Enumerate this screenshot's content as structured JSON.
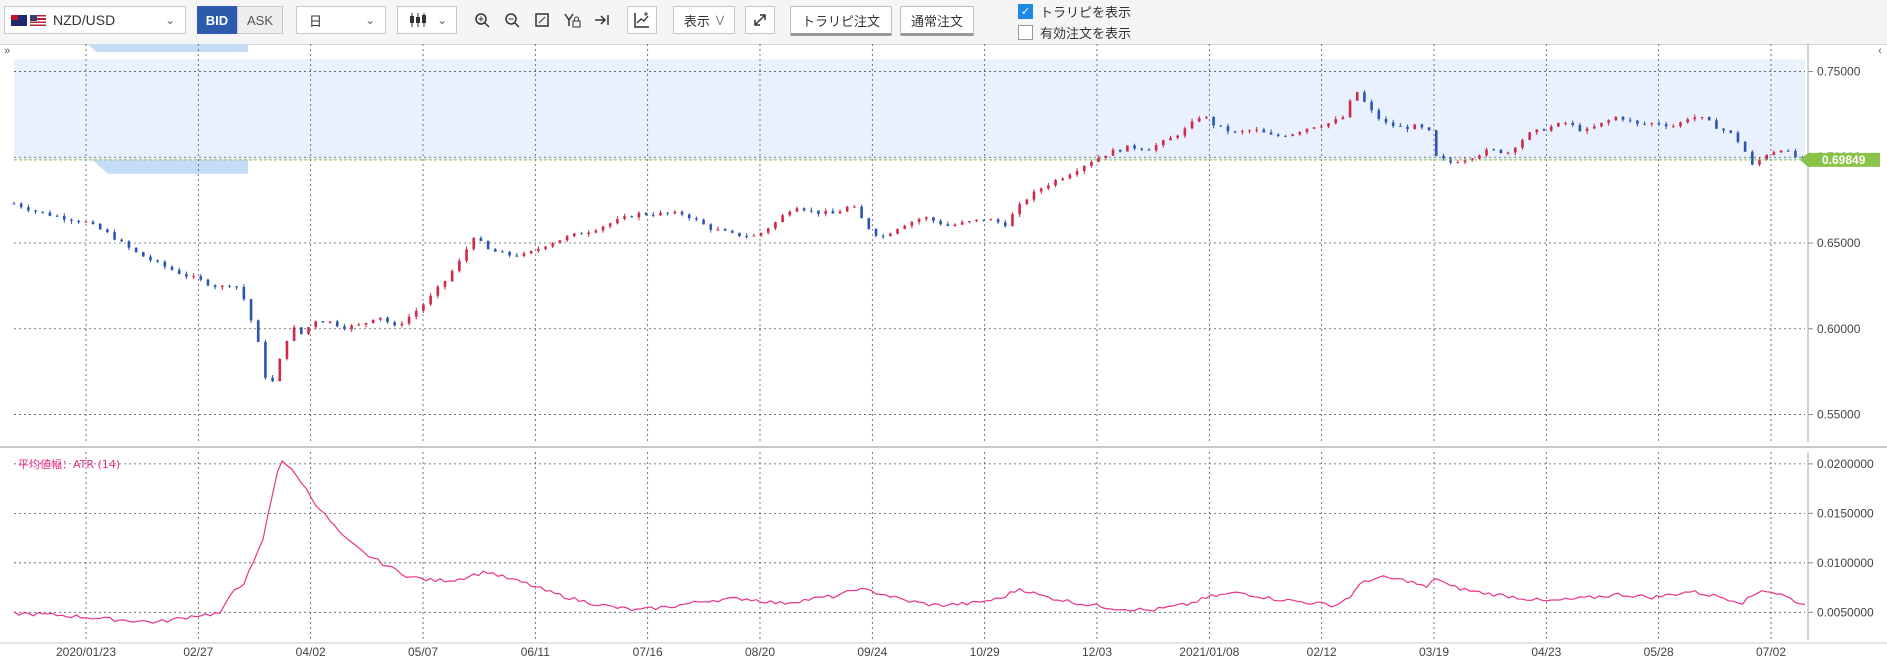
{
  "toolbar": {
    "pair": "NZD/USD",
    "bid": "BID",
    "ask": "ASK",
    "timeframe": "日",
    "display_label": "表示",
    "trapi_order": "トラリピ注文",
    "normal_order": "通常注文",
    "show_trapi": "トラリピを表示",
    "show_active": "有効注文を表示",
    "show_trapi_checked": true,
    "show_active_checked": false
  },
  "icons": [
    "candlestick-icon",
    "zoom-in-icon",
    "zoom-out-icon",
    "fit-icon",
    "y-lock-icon",
    "scroll-end-icon",
    "indicator-icon",
    "expand-icon"
  ],
  "colors": {
    "up": "#d0294a",
    "down": "#2a55b3",
    "atr": "#e8338a",
    "price_tag": "#8bc34a",
    "range_fill": "#e8f1fd"
  },
  "chart_data": [
    {
      "type": "candlestick",
      "pair": "NZD/USD",
      "y_ticks": [
        "0.75000",
        "0.70000",
        "0.65000",
        "0.60000",
        "0.55000"
      ],
      "ylim": [
        0.534,
        0.766
      ],
      "current_price": "0.69849",
      "trapi_range": [
        0.6985,
        0.757
      ],
      "x_ticks": [
        "2020/01/23",
        "02/27",
        "04/02",
        "05/07",
        "06/11",
        "07/16",
        "08/20",
        "09/24",
        "10/29",
        "12/03",
        "2021/01/08",
        "02/12",
        "03/19",
        "04/23",
        "05/28",
        "07/02"
      ],
      "close_path": [
        [
          0,
          0.673
        ],
        [
          10,
          0.668
        ],
        [
          20,
          0.665
        ],
        [
          30,
          0.662
        ],
        [
          40,
          0.655
        ],
        [
          50,
          0.645
        ],
        [
          60,
          0.638
        ],
        [
          70,
          0.632
        ],
        [
          78,
          0.628
        ],
        [
          86,
          0.624
        ],
        [
          92,
          0.627
        ],
        [
          97,
          0.615
        ],
        [
          100,
          0.6
        ],
        [
          103,
          0.587
        ],
        [
          106,
          0.565
        ],
        [
          109,
          0.571
        ],
        [
          112,
          0.587
        ],
        [
          116,
          0.601
        ],
        [
          120,
          0.597
        ],
        [
          126,
          0.605
        ],
        [
          132,
          0.604
        ],
        [
          138,
          0.601
        ],
        [
          145,
          0.602
        ],
        [
          152,
          0.608
        ],
        [
          159,
          0.601
        ],
        [
          166,
          0.608
        ],
        [
          173,
          0.617
        ],
        [
          180,
          0.628
        ],
        [
          186,
          0.639
        ],
        [
          192,
          0.654
        ],
        [
          198,
          0.646
        ],
        [
          206,
          0.643
        ],
        [
          214,
          0.643
        ],
        [
          222,
          0.649
        ],
        [
          230,
          0.653
        ],
        [
          240,
          0.657
        ],
        [
          250,
          0.662
        ],
        [
          260,
          0.667
        ],
        [
          270,
          0.667
        ],
        [
          280,
          0.667
        ],
        [
          290,
          0.659
        ],
        [
          300,
          0.655
        ],
        [
          310,
          0.654
        ],
        [
          318,
          0.662
        ],
        [
          326,
          0.672
        ],
        [
          334,
          0.668
        ],
        [
          342,
          0.667
        ],
        [
          350,
          0.672
        ],
        [
          356,
          0.66
        ],
        [
          362,
          0.653
        ],
        [
          370,
          0.66
        ],
        [
          380,
          0.665
        ],
        [
          390,
          0.66
        ],
        [
          398,
          0.662
        ],
        [
          406,
          0.664
        ],
        [
          414,
          0.661
        ],
        [
          422,
          0.675
        ],
        [
          430,
          0.683
        ],
        [
          440,
          0.69
        ],
        [
          450,
          0.698
        ],
        [
          458,
          0.703
        ],
        [
          466,
          0.706
        ],
        [
          474,
          0.705
        ],
        [
          482,
          0.71
        ],
        [
          490,
          0.717
        ],
        [
          496,
          0.725
        ],
        [
          502,
          0.718
        ],
        [
          510,
          0.714
        ],
        [
          518,
          0.716
        ],
        [
          526,
          0.712
        ],
        [
          534,
          0.714
        ],
        [
          542,
          0.718
        ],
        [
          550,
          0.72
        ],
        [
          556,
          0.724
        ],
        [
          560,
          0.74
        ],
        [
          566,
          0.728
        ],
        [
          572,
          0.72
        ],
        [
          580,
          0.717
        ],
        [
          586,
          0.718
        ],
        [
          592,
          0.714
        ],
        [
          594,
          0.7
        ],
        [
          600,
          0.697
        ],
        [
          608,
          0.7
        ],
        [
          616,
          0.704
        ],
        [
          624,
          0.703
        ],
        [
          632,
          0.713
        ],
        [
          640,
          0.717
        ],
        [
          648,
          0.72
        ],
        [
          656,
          0.715
        ],
        [
          664,
          0.72
        ],
        [
          670,
          0.724
        ],
        [
          678,
          0.719
        ],
        [
          686,
          0.72
        ],
        [
          694,
          0.718
        ],
        [
          700,
          0.724
        ],
        [
          706,
          0.722
        ],
        [
          712,
          0.717
        ],
        [
          718,
          0.713
        ],
        [
          722,
          0.706
        ],
        [
          726,
          0.695
        ],
        [
          732,
          0.702
        ],
        [
          738,
          0.705
        ],
        [
          744,
          0.7
        ],
        [
          748,
          0.698
        ]
      ],
      "n_bars": 749
    },
    {
      "type": "line",
      "label": "平均値幅：ATR (14)",
      "y_ticks": [
        "0.0200000",
        "0.0150000",
        "0.0100000",
        "0.0050000"
      ],
      "ylim": [
        0.0022,
        0.0212
      ],
      "path": [
        [
          0,
          0.0049
        ],
        [
          20,
          0.0047
        ],
        [
          40,
          0.0043
        ],
        [
          60,
          0.004
        ],
        [
          70,
          0.0044
        ],
        [
          76,
          0.0047
        ],
        [
          82,
          0.0048
        ],
        [
          86,
          0.0049
        ],
        [
          88,
          0.0056
        ],
        [
          92,
          0.0073
        ],
        [
          96,
          0.008
        ],
        [
          100,
          0.0099
        ],
        [
          104,
          0.0124
        ],
        [
          107,
          0.0158
        ],
        [
          110,
          0.0193
        ],
        [
          112,
          0.0204
        ],
        [
          115,
          0.0196
        ],
        [
          120,
          0.0182
        ],
        [
          125,
          0.0163
        ],
        [
          131,
          0.0145
        ],
        [
          138,
          0.0125
        ],
        [
          146,
          0.011
        ],
        [
          155,
          0.0098
        ],
        [
          165,
          0.0086
        ],
        [
          175,
          0.0082
        ],
        [
          185,
          0.0083
        ],
        [
          192,
          0.0088
        ],
        [
          198,
          0.0091
        ],
        [
          205,
          0.0085
        ],
        [
          214,
          0.0079
        ],
        [
          224,
          0.007
        ],
        [
          236,
          0.0062
        ],
        [
          248,
          0.0056
        ],
        [
          260,
          0.0052
        ],
        [
          275,
          0.0056
        ],
        [
          290,
          0.0062
        ],
        [
          305,
          0.0064
        ],
        [
          320,
          0.0059
        ],
        [
          335,
          0.0064
        ],
        [
          345,
          0.0067
        ],
        [
          352,
          0.0074
        ],
        [
          362,
          0.0069
        ],
        [
          372,
          0.0062
        ],
        [
          385,
          0.0057
        ],
        [
          400,
          0.0059
        ],
        [
          412,
          0.0064
        ],
        [
          420,
          0.0074
        ],
        [
          430,
          0.0066
        ],
        [
          445,
          0.0059
        ],
        [
          460,
          0.0054
        ],
        [
          475,
          0.0052
        ],
        [
          490,
          0.0058
        ],
        [
          500,
          0.0066
        ],
        [
          512,
          0.007
        ],
        [
          525,
          0.0064
        ],
        [
          540,
          0.006
        ],
        [
          552,
          0.0057
        ],
        [
          558,
          0.0066
        ],
        [
          564,
          0.0082
        ],
        [
          572,
          0.0085
        ],
        [
          582,
          0.0082
        ],
        [
          590,
          0.0075
        ],
        [
          594,
          0.0085
        ],
        [
          600,
          0.0076
        ],
        [
          612,
          0.007
        ],
        [
          625,
          0.0066
        ],
        [
          640,
          0.0061
        ],
        [
          655,
          0.0064
        ],
        [
          670,
          0.0068
        ],
        [
          685,
          0.0065
        ],
        [
          700,
          0.0071
        ],
        [
          712,
          0.0066
        ],
        [
          722,
          0.006
        ],
        [
          730,
          0.0073
        ],
        [
          738,
          0.0068
        ],
        [
          748,
          0.0057
        ]
      ]
    }
  ]
}
